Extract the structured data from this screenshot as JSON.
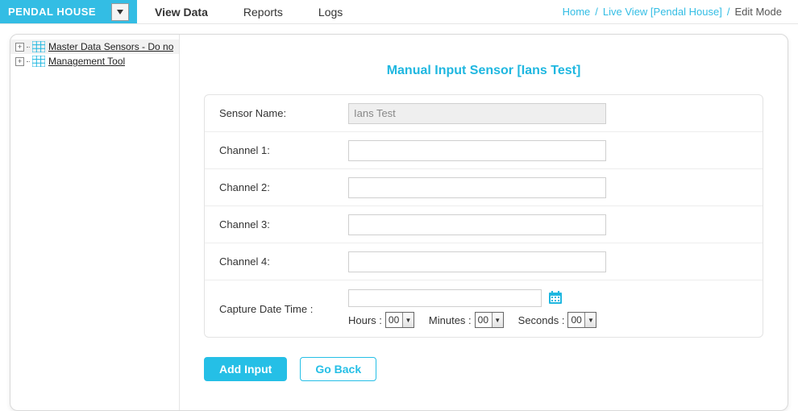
{
  "topbar": {
    "house_label": "PENDAL HOUSE",
    "nav": {
      "view_data": "View Data",
      "reports": "Reports",
      "logs": "Logs"
    },
    "breadcrumb": {
      "home": "Home",
      "live_view": "Live View [Pendal House]",
      "current": "Edit Mode"
    }
  },
  "tree": {
    "item0": "Master Data Sensors - Do no",
    "item1": "Management Tool"
  },
  "form": {
    "title": "Manual Input Sensor [Ians Test]",
    "labels": {
      "sensor_name": "Sensor Name:",
      "channel1": "Channel 1:",
      "channel2": "Channel 2:",
      "channel3": "Channel 3:",
      "channel4": "Channel 4:",
      "capture": "Capture Date Time :",
      "hours": "Hours :",
      "minutes": "Minutes :",
      "seconds": "Seconds :"
    },
    "values": {
      "sensor_name": "Ians Test",
      "channel1": "",
      "channel2": "",
      "channel3": "",
      "channel4": "",
      "date": "",
      "hours": "00",
      "minutes": "00",
      "seconds": "00"
    }
  },
  "buttons": {
    "add_input": "Add Input",
    "go_back": "Go Back"
  }
}
